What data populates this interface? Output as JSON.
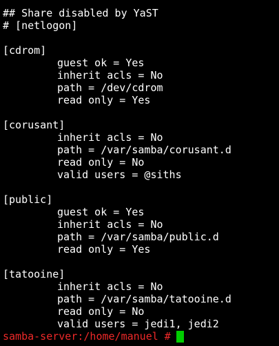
{
  "terminal": {
    "lines": [
      "## Share disabled by YaST",
      "# [netlogon]",
      "",
      "[cdrom]",
      "guest ok = Yes",
      "inherit acls = No",
      "path = /dev/cdrom",
      "read only = Yes",
      "",
      "[corusant]",
      "inherit acls = No",
      "path = /var/samba/corusant.d",
      "read only = No",
      "valid users = @siths",
      "",
      "[public]",
      "guest ok = Yes",
      "inherit acls = No",
      "path = /var/samba/public.d",
      "read only = Yes",
      "",
      "[tatooine]",
      "inherit acls = No",
      "path = /var/samba/tatooine.d",
      "read only = No",
      "valid users = jedi1, jedi2"
    ],
    "prompt": "samba-server:/home/manuel #",
    "cursor_color": "#00cc00",
    "prompt_color": "#ef2929"
  }
}
